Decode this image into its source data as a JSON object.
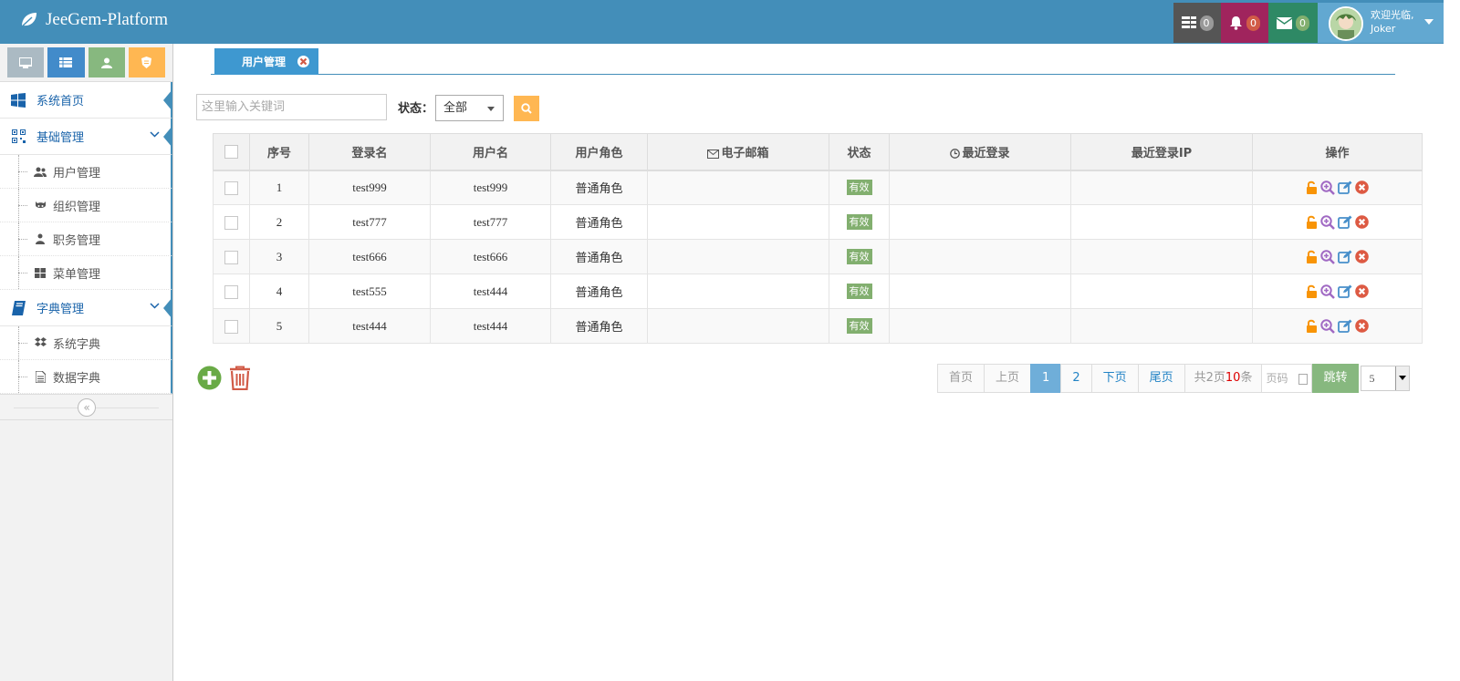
{
  "app": {
    "title": "JeeGem-Platform"
  },
  "header": {
    "tasks": {
      "icon": "tasks-icon",
      "count": "0",
      "bg": "#555555",
      "badge_color": "#999999"
    },
    "notifications": {
      "icon": "bell-icon",
      "count": "0",
      "bg": "#a00f4b",
      "badge_color": "#d15b47"
    },
    "messages": {
      "icon": "envelope-icon",
      "count": "0",
      "bg": "#2e8965",
      "badge_color": "#82af6f"
    },
    "user": {
      "welcome": "欢迎光临,",
      "name": "Joker"
    }
  },
  "sidebar": {
    "shortcuts": [
      {
        "icon": "desktop-icon",
        "color": "#abbac3"
      },
      {
        "icon": "list-icon",
        "color": "#428bca"
      },
      {
        "icon": "user-icon",
        "color": "#87b87f"
      },
      {
        "icon": "shield-icon",
        "color": "#ffb752"
      }
    ],
    "home": {
      "label": "系统首页",
      "icon": "windows-icon"
    },
    "base": {
      "label": "基础管理",
      "icon": "qrcode-icon"
    },
    "base_items": [
      {
        "label": "用户管理",
        "icon": "users-icon"
      },
      {
        "label": "组织管理",
        "icon": "github-icon"
      },
      {
        "label": "职务管理",
        "icon": "sitemap-icon"
      },
      {
        "label": "菜单管理",
        "icon": "th-large-icon"
      }
    ],
    "dict": {
      "label": "字典管理",
      "icon": "book-icon"
    },
    "dict_items": [
      {
        "label": "系统字典",
        "icon": "dropbox-icon"
      },
      {
        "label": "数据字典",
        "icon": "file-icon"
      }
    ],
    "collapse": "«"
  },
  "tabs": [
    {
      "label": "用户管理"
    }
  ],
  "search": {
    "placeholder": "这里输入关键词",
    "status_label": "状态：",
    "status_value": "全部"
  },
  "table": {
    "columns": [
      "序号",
      "登录名",
      "用户名",
      "用户角色",
      "电子邮箱",
      "状态",
      "最近登录",
      "最近登录IP",
      "操作"
    ],
    "rows": [
      {
        "no": "1",
        "login": "test999",
        "username": "test999",
        "role": "普通角色",
        "email": "",
        "status": "有效",
        "last_login": "",
        "last_ip": ""
      },
      {
        "no": "2",
        "login": "test777",
        "username": "test777",
        "role": "普通角色",
        "email": "",
        "status": "有效",
        "last_login": "",
        "last_ip": ""
      },
      {
        "no": "3",
        "login": "test666",
        "username": "test666",
        "role": "普通角色",
        "email": "",
        "status": "有效",
        "last_login": "",
        "last_ip": ""
      },
      {
        "no": "4",
        "login": "test555",
        "username": "test444",
        "role": "普通角色",
        "email": "",
        "status": "有效",
        "last_login": "",
        "last_ip": ""
      },
      {
        "no": "5",
        "login": "test444",
        "username": "test444",
        "role": "普通角色",
        "email": "",
        "status": "有效",
        "last_login": "",
        "last_ip": ""
      }
    ]
  },
  "pager": {
    "first": "首页",
    "prev": "上页",
    "pages": [
      "1",
      "2"
    ],
    "current": "1",
    "next": "下页",
    "last": "尾页",
    "total_prefix": "共2页",
    "total_count": "10",
    "total_suffix": "条",
    "page_input_placeholder": "页码",
    "jump": "跳转",
    "page_size": "5"
  },
  "colors": {
    "primary": "#438eb9",
    "tab": "#3e98d0",
    "success": "#82af6f",
    "warning": "#ffb752",
    "danger": "#d15b47",
    "search_btn": "#ffb752"
  }
}
